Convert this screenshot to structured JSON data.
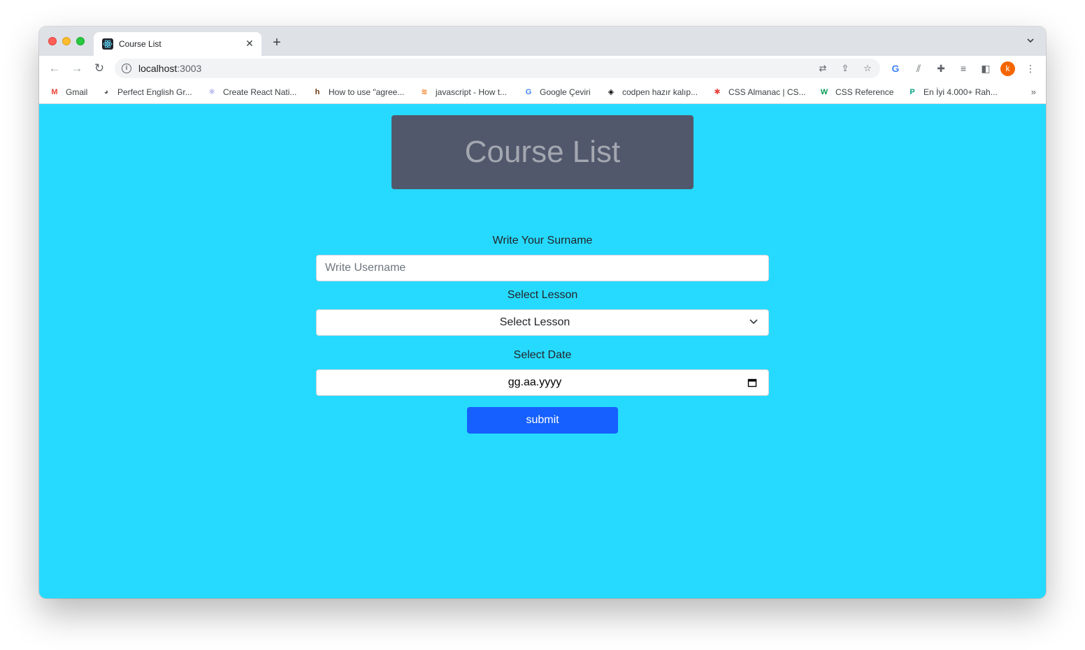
{
  "browser": {
    "tab_title": "Course List",
    "tab_close": "✕",
    "new_tab": "+",
    "tabs_dropdown": "⌄",
    "url_host": "localhost",
    "url_port": ":3003",
    "avatar_letter": "k",
    "bookmarks": [
      {
        "label": "Gmail",
        "icon": "gmail-icon",
        "glyph": "M",
        "color": "#ea4335"
      },
      {
        "label": "Perfect English Gr...",
        "icon": "globe-icon",
        "glyph": "◕",
        "color": "#5f6368"
      },
      {
        "label": "Create React Nati...",
        "icon": "react-icon",
        "glyph": "⚛",
        "color": "#5b5bd6"
      },
      {
        "label": "How to use \"agree...",
        "icon": "hashnode-icon",
        "glyph": "h",
        "color": "#6b3a13"
      },
      {
        "label": "javascript - How t...",
        "icon": "stackoverflow-icon",
        "glyph": "≋",
        "color": "#f48024"
      },
      {
        "label": "Google Çeviri",
        "icon": "google-translate-icon",
        "glyph": "G",
        "color": "#4285f4"
      },
      {
        "label": "codpen hazır kalıp...",
        "icon": "codepen-icon",
        "glyph": "◈",
        "color": "#000000"
      },
      {
        "label": "CSS Almanac | CS...",
        "icon": "css-tricks-icon",
        "glyph": "✱",
        "color": "#e8413a"
      },
      {
        "label": "CSS Reference",
        "icon": "w3-icon",
        "glyph": "W",
        "color": "#0a9d58"
      },
      {
        "label": "En İyi 4.000+ Rah...",
        "icon": "pexels-icon",
        "glyph": "P",
        "color": "#05a081"
      }
    ],
    "bookmarks_overflow": "»"
  },
  "page": {
    "header_title": "Course List",
    "surname_label": "Write Your Surname",
    "username_placeholder": "Write Username",
    "lesson_label": "Select Lesson",
    "lesson_selected": "Select Lesson",
    "date_label": "Select Date",
    "date_placeholder": "gg.aa.yyyy",
    "submit_label": "submit"
  },
  "colors": {
    "page_background": "#26daff",
    "header_background": "#52586b",
    "header_text": "#a3a7b0",
    "submit_background": "#1560ff"
  }
}
